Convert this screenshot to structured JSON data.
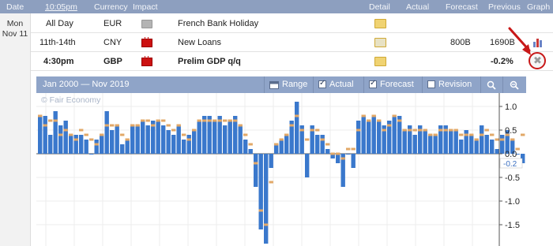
{
  "header": {
    "date": "Date",
    "time": "10:05pm",
    "currency": "Currency",
    "impact": "Impact",
    "detail": "Detail",
    "actual": "Actual",
    "forecast": "Forecast",
    "previous": "Previous",
    "graph": "Graph"
  },
  "date_block": {
    "weekday": "Mon",
    "day": "Nov 11"
  },
  "events": [
    {
      "time": "All Day",
      "currency": "EUR",
      "impact": "gray",
      "event": "French Bank Holiday",
      "actual": "",
      "forecast": "",
      "previous": ""
    },
    {
      "time": "11th-14th",
      "currency": "CNY",
      "impact": "red",
      "event": "New Loans",
      "actual": "",
      "forecast": "800B",
      "previous": "1690B"
    },
    {
      "time": "4:30pm",
      "currency": "GBP",
      "impact": "red",
      "event": "Prelim GDP q/q",
      "actual": "",
      "forecast": "",
      "previous": "-0.2%"
    }
  ],
  "chart_panel": {
    "range_text": "Jan 2000 — Nov 2019",
    "range_button": "Range",
    "actual_toggle": "Actual",
    "forecast_toggle": "Forecast",
    "revision_toggle": "Revision",
    "actual_checked": true,
    "forecast_checked": true,
    "revision_checked": false,
    "watermark": "© Fair Economy"
  },
  "colors": {
    "header_bg": "#8d9fbf",
    "bar_actual": "#3a78cc",
    "bar_forecast": "#e2a868",
    "impact_red": "#cc1111",
    "annotation_red": "#c81818"
  },
  "chart_data": {
    "type": "bar",
    "title": "",
    "xlabel": "",
    "ylabel": "",
    "ylim": [
      -1.9,
      1.2
    ],
    "yticks": [
      "1.0",
      "0.5",
      "0.0",
      "-0.5",
      "-1.0",
      "-1.5"
    ],
    "last_value_label": "-0.2",
    "series": [
      {
        "name": "Actual",
        "values": [
          0.8,
          0.8,
          0.4,
          0.9,
          0.6,
          0.7,
          0.4,
          0.4,
          0.4,
          0.3,
          0.0,
          0.3,
          0.4,
          0.9,
          0.5,
          0.6,
          0.2,
          0.3,
          0.6,
          0.6,
          0.7,
          0.6,
          0.7,
          0.7,
          0.6,
          0.5,
          0.4,
          0.6,
          0.3,
          0.4,
          0.5,
          0.7,
          0.8,
          0.8,
          0.7,
          0.8,
          0.6,
          0.7,
          0.8,
          0.6,
          0.3,
          0.1,
          -0.7,
          -1.6,
          -1.9,
          -0.3,
          0.2,
          0.3,
          0.4,
          0.7,
          1.1,
          0.6,
          -0.5,
          0.6,
          0.4,
          0.4,
          0.1,
          -0.1,
          -0.2,
          -0.7,
          0.0,
          -0.3,
          0.7,
          0.8,
          0.7,
          0.8,
          0.7,
          0.6,
          0.7,
          0.8,
          0.8,
          0.5,
          0.6,
          0.4,
          0.6,
          0.5,
          0.4,
          0.4,
          0.6,
          0.6,
          0.5,
          0.5,
          0.3,
          0.5,
          0.4,
          0.3,
          0.6,
          0.4,
          0.3,
          0.1,
          0.4,
          0.5,
          0.3,
          0.0,
          -0.2
        ]
      },
      {
        "name": "Forecast",
        "values": [
          0.8,
          0.6,
          0.7,
          0.7,
          0.4,
          0.5,
          0.4,
          0.3,
          0.5,
          0.4,
          0.3,
          0.2,
          0.4,
          0.6,
          0.6,
          0.6,
          0.4,
          0.3,
          0.6,
          0.6,
          0.7,
          0.7,
          0.6,
          0.7,
          0.7,
          0.6,
          0.5,
          0.6,
          0.4,
          0.3,
          0.5,
          0.7,
          0.7,
          0.7,
          0.7,
          0.7,
          0.7,
          0.7,
          0.7,
          0.6,
          0.4,
          0.2,
          -0.2,
          -1.2,
          -1.5,
          -0.6,
          0.2,
          0.3,
          0.4,
          0.6,
          0.8,
          0.5,
          0.3,
          0.5,
          0.5,
          0.3,
          0.2,
          0.0,
          0.0,
          -0.1,
          0.1,
          0.1,
          0.5,
          0.8,
          0.7,
          0.8,
          0.7,
          0.5,
          0.6,
          0.8,
          0.7,
          0.5,
          0.5,
          0.5,
          0.5,
          0.5,
          0.4,
          0.4,
          0.5,
          0.5,
          0.5,
          0.5,
          0.4,
          0.4,
          0.4,
          0.3,
          0.4,
          0.5,
          0.4,
          0.3,
          0.3,
          0.4,
          0.3,
          0.1,
          0.4
        ]
      }
    ],
    "legend": "none",
    "grid": true
  }
}
